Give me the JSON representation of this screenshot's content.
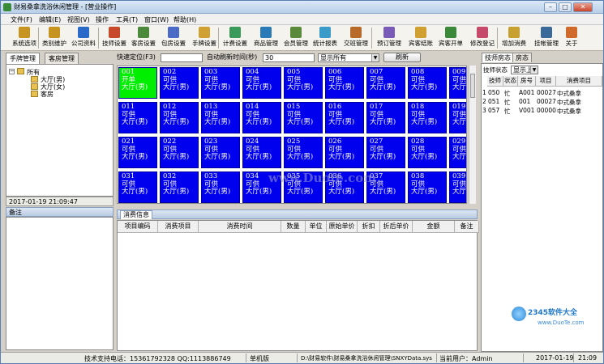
{
  "window": {
    "title": "财易桑拿洗浴休闲管理 - [营业操作]"
  },
  "menu": [
    "文件(F)",
    "编辑(E)",
    "视图(V)",
    "操作",
    "工具(T)",
    "窗口(W)",
    "帮助(H)"
  ],
  "toolbar": [
    {
      "label": "系统选项",
      "icon": "gear-icon",
      "color": "#c89420"
    },
    {
      "label": "类别维护",
      "icon": "folder-icon",
      "color": "#c89420"
    },
    {
      "label": "公司资料",
      "icon": "building-icon",
      "color": "#2a6ac8"
    },
    {
      "label": "技师设置",
      "icon": "person-icon",
      "color": "#c84a2a"
    },
    {
      "label": "客房设置",
      "icon": "room-icon",
      "color": "#4a8a3a"
    },
    {
      "label": "包房设置",
      "icon": "room-icon",
      "color": "#4a6ac8"
    },
    {
      "label": "手牌设置",
      "icon": "hand-icon",
      "color": "#d0a030"
    },
    {
      "label": "计费设置",
      "icon": "billing-icon",
      "color": "#3a9a5a"
    },
    {
      "label": "商品管理",
      "icon": "goods-icon",
      "color": "#2a7ab8"
    },
    {
      "label": "会员管理",
      "icon": "member-icon",
      "color": "#5a8a3a"
    },
    {
      "label": "统计报表",
      "icon": "chart-icon",
      "color": "#3a9ac8"
    },
    {
      "label": "交班管理",
      "icon": "shift-icon",
      "color": "#b86a2a"
    },
    {
      "label": "预订管理",
      "icon": "booking-icon",
      "color": "#7a5ab8"
    },
    {
      "label": "宾客结账",
      "icon": "checkout-icon",
      "color": "#d0a030"
    },
    {
      "label": "宾客开单",
      "icon": "checkin-icon",
      "color": "#3a8a3a"
    },
    {
      "label": "修改登记",
      "icon": "edit-icon",
      "color": "#c84a6a"
    },
    {
      "label": "增加消费",
      "icon": "add-icon",
      "color": "#c8a030"
    },
    {
      "label": "挂帐管理",
      "icon": "ledger-icon",
      "color": "#3a6a9a"
    },
    {
      "label": "关于",
      "icon": "info-icon",
      "color": "#d06a2a"
    }
  ],
  "left_tabs": [
    "手牌管理",
    "客房管理"
  ],
  "tree": {
    "root": "所有",
    "children": [
      "大厅(男)",
      "大厅(女)",
      "客房"
    ]
  },
  "datetime": "2017-01-19 21:09:47",
  "notes_title": "备注",
  "filter": {
    "quick_locate_label": "快速定位(F3)",
    "quick_locate_value": "",
    "auto_refresh_label": "自动刷新时间(秒)",
    "auto_refresh_value": "30",
    "display_select": "显示所有",
    "refresh_button": "刷新"
  },
  "cells": [
    {
      "no": "001",
      "state": "开单",
      "area": "大厅(男)",
      "free": false
    },
    {
      "no": "002",
      "state": "可供",
      "area": "大厅(男)",
      "free": true
    },
    {
      "no": "003",
      "state": "可供",
      "area": "大厅(男)",
      "free": true
    },
    {
      "no": "004",
      "state": "可供",
      "area": "大厅(男)",
      "free": true
    },
    {
      "no": "005",
      "state": "可供",
      "area": "大厅(男)",
      "free": true
    },
    {
      "no": "006",
      "state": "可供",
      "area": "大厅(男)",
      "free": true
    },
    {
      "no": "007",
      "state": "可供",
      "area": "大厅(男)",
      "free": true
    },
    {
      "no": "008",
      "state": "可供",
      "area": "大厅(男)",
      "free": true
    },
    {
      "no": "009",
      "state": "可供",
      "area": "大厅(男)",
      "free": true
    },
    {
      "no": "011",
      "state": "可供",
      "area": "大厅(男)",
      "free": true
    },
    {
      "no": "012",
      "state": "可供",
      "area": "大厅(男)",
      "free": true
    },
    {
      "no": "013",
      "state": "可供",
      "area": "大厅(男)",
      "free": true
    },
    {
      "no": "014",
      "state": "可供",
      "area": "大厅(男)",
      "free": true
    },
    {
      "no": "015",
      "state": "可供",
      "area": "大厅(男)",
      "free": true
    },
    {
      "no": "016",
      "state": "可供",
      "area": "大厅(男)",
      "free": true
    },
    {
      "no": "017",
      "state": "可供",
      "area": "大厅(男)",
      "free": true
    },
    {
      "no": "018",
      "state": "可供",
      "area": "大厅(男)",
      "free": true
    },
    {
      "no": "019",
      "state": "可供",
      "area": "大厅(男)",
      "free": true
    },
    {
      "no": "021",
      "state": "可供",
      "area": "大厅(男)",
      "free": true
    },
    {
      "no": "022",
      "state": "可供",
      "area": "大厅(男)",
      "free": true
    },
    {
      "no": "023",
      "state": "可供",
      "area": "大厅(男)",
      "free": true
    },
    {
      "no": "024",
      "state": "可供",
      "area": "大厅(男)",
      "free": true
    },
    {
      "no": "025",
      "state": "可供",
      "area": "大厅(男)",
      "free": true
    },
    {
      "no": "026",
      "state": "可供",
      "area": "大厅(男)",
      "free": true
    },
    {
      "no": "027",
      "state": "可供",
      "area": "大厅(男)",
      "free": true
    },
    {
      "no": "028",
      "state": "可供",
      "area": "大厅(男)",
      "free": true
    },
    {
      "no": "029",
      "state": "可供",
      "area": "大厅(男)",
      "free": true
    },
    {
      "no": "031",
      "state": "可供",
      "area": "大厅(男)",
      "free": true
    },
    {
      "no": "032",
      "state": "可供",
      "area": "大厅(男)",
      "free": true
    },
    {
      "no": "033",
      "state": "可供",
      "area": "大厅(男)",
      "free": true
    },
    {
      "no": "034",
      "state": "可供",
      "area": "大厅(男)",
      "free": true
    },
    {
      "no": "035",
      "state": "可供",
      "area": "大厅(男)",
      "free": true
    },
    {
      "no": "036",
      "state": "可供",
      "area": "大厅(男)",
      "free": true
    },
    {
      "no": "037",
      "state": "可供",
      "area": "大厅(男)",
      "free": true
    },
    {
      "no": "038",
      "state": "可供",
      "area": "大厅(男)",
      "free": true
    },
    {
      "no": "039",
      "state": "可供",
      "area": "大厅(男)",
      "free": true
    }
  ],
  "consumption": {
    "tab": "消费信息",
    "columns": [
      "项目编码",
      "消费项目",
      "消费时间",
      "数量",
      "单位",
      "原始单价",
      "折扣",
      "折后单价",
      "金额",
      "备注"
    ]
  },
  "right": {
    "tabs": [
      "技师房态",
      "房态"
    ],
    "status_label": "技师状态",
    "status_select": "显示上",
    "columns": [
      "技师",
      "状态",
      "房号",
      "项目",
      "消费项目"
    ],
    "rows": [
      {
        "idx": "1",
        "tech": "050",
        "state": "忙",
        "room": "A001",
        "item": "00027",
        "name": "中式桑拿"
      },
      {
        "idx": "2",
        "tech": "051",
        "state": "忙",
        "room": "001",
        "item": "00027",
        "name": "中式桑拿"
      },
      {
        "idx": "3",
        "tech": "057",
        "state": "忙",
        "room": "V001",
        "item": "00000",
        "name": "中式桑拿"
      }
    ]
  },
  "status": {
    "support": "技术支持电话：15361792328 QQ:1113886749",
    "edition": "单机版",
    "path": "D:\\财易软件\\财易桑拿洗浴休闲管理\\SNXYData.sys",
    "user": "当前用户：Admin",
    "date": "2017-01-19",
    "time": "21:09"
  },
  "watermarks": {
    "center": "www.Duote.com",
    "brand": "2345软件大全",
    "brand_sub": "www.DuoTe.com"
  },
  "colors": {
    "occupied": "#00ee00",
    "available": "#0000ee",
    "cell_text": "#ffffff"
  }
}
